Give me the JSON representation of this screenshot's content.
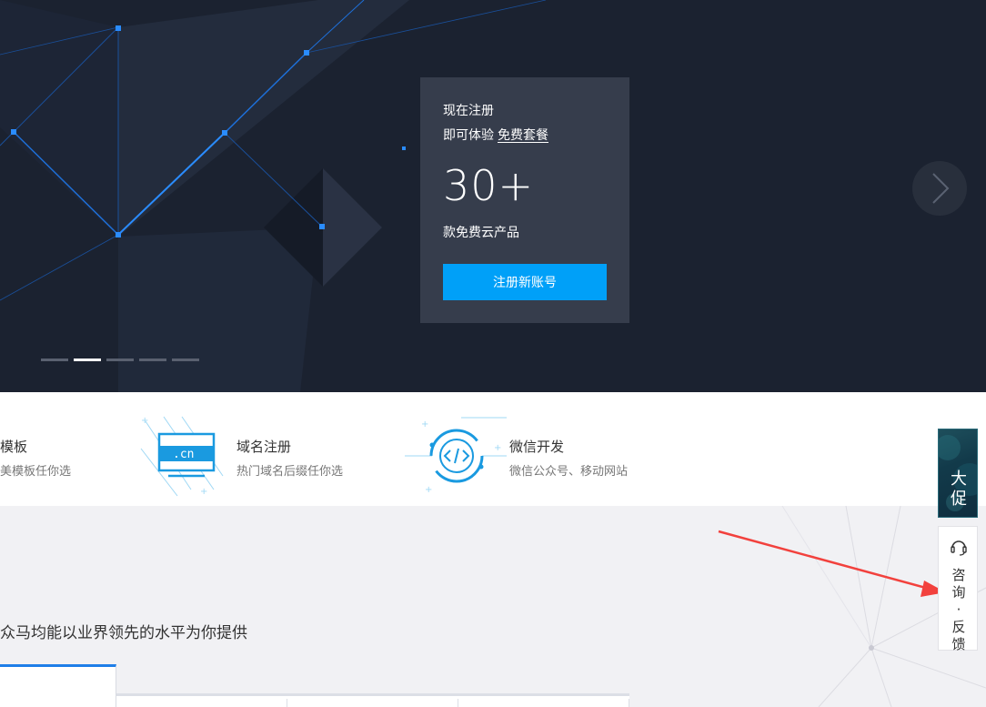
{
  "hero": {
    "promo": {
      "line1": "现在注册",
      "line2_prefix": "即可体验",
      "line2_link": "免费套餐",
      "number": "30+",
      "subtitle": "款免费云产品",
      "button": "注册新账号"
    },
    "carousel": {
      "count": 5,
      "active_index": 1
    },
    "colors": {
      "background": "#1b2230",
      "card": "#363d4c",
      "button": "#00a0f8"
    }
  },
  "features": [
    {
      "icon": "template-icon",
      "title": "模板",
      "desc": "美模板任你选"
    },
    {
      "icon": "domain-cn-icon",
      "title": "域名注册",
      "desc": "热门域名后缀任你选",
      "icon_text": ".cn"
    },
    {
      "icon": "wechat-code-icon",
      "title": "微信开发",
      "desc": "微信公众号、移动网站"
    }
  ],
  "lower": {
    "text": "众马均能以业界领先的水平为你提供"
  },
  "floating": {
    "promo_label": "大促",
    "feedback_label": "咨询·反馈"
  }
}
